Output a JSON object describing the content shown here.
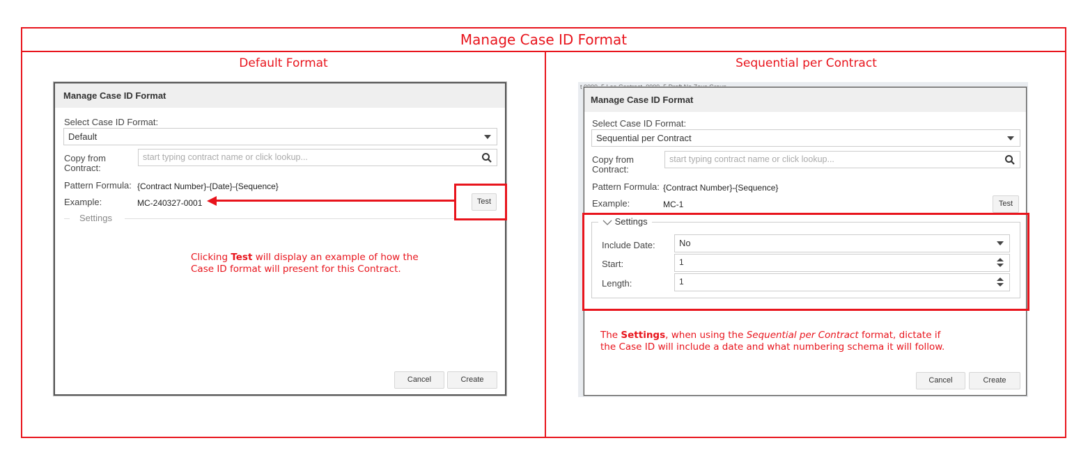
{
  "page": {
    "title": "Manage Case ID Format",
    "columns": [
      {
        "title": "Default Format"
      },
      {
        "title": "Sequential per Contract"
      }
    ]
  },
  "dialog_default": {
    "title": "Manage Case ID Format",
    "select_label": "Select Case ID Format:",
    "select_value": "Default",
    "copy_label_line1": "Copy from",
    "copy_label_line2": "Contract:",
    "copy_placeholder": "start typing contract name or click lookup...",
    "pattern_label": "Pattern Formula:",
    "pattern_value": "{Contract Number}-{Date}-{Sequence}",
    "example_label": "Example:",
    "example_value": "MC-240327-0001",
    "test_label": "Test",
    "settings_label": "Settings",
    "cancel_label": "Cancel",
    "create_label": "Create"
  },
  "dialog_sequential": {
    "title": "Manage Case ID Format",
    "select_label": "Select Case ID Format:",
    "select_value": "Sequential per Contract",
    "copy_label_line1": "Copy from",
    "copy_label_line2": "Contract:",
    "copy_placeholder": "start typing contract name or click lookup...",
    "pattern_label": "Pattern Formula:",
    "pattern_value": "{Contract Number}-{Sequence}",
    "example_label": "Example:",
    "example_value": "MC-1",
    "test_label": "Test",
    "settings_label": "Settings",
    "include_date_label": "Include Date:",
    "include_date_value": "No",
    "start_label": "Start:",
    "start_value": "1",
    "length_label": "Length:",
    "length_value": "1",
    "cancel_label": "Cancel",
    "create_label": "Create"
  },
  "annotations": {
    "test_note": {
      "pre": "Clicking ",
      "bold": "Test",
      "post_line1": " will display an example of how the",
      "line2": "Case ID format will present for this Contract."
    },
    "settings_note": {
      "pre": "The ",
      "bold": "Settings",
      "mid": ", when using the ",
      "italic": "Sequential per Contract",
      "post_line1": " format, dictate if",
      "line2": "the Case ID will include a date and what numbering schema it will follow."
    }
  },
  "colors": {
    "annotation_red": "#e8141c",
    "dialog_header_bg": "#efefef"
  }
}
